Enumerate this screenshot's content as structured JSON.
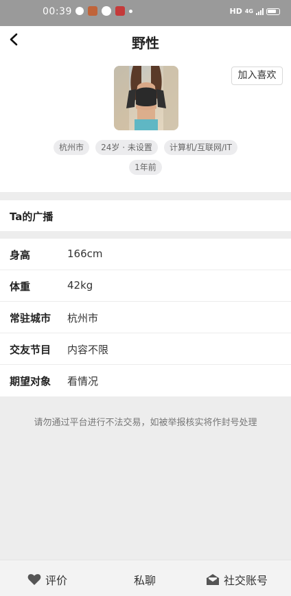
{
  "status_bar": {
    "time": "00:39",
    "network": "HD",
    "signal_type": "4G"
  },
  "header": {
    "title": "野性"
  },
  "profile": {
    "favorite_label": "加入喜欢",
    "tags": [
      "杭州市",
      "24岁 · 未设置",
      "计算机/互联网/IT"
    ],
    "last_active": "1年前"
  },
  "broadcast": {
    "title": "Ta的广播"
  },
  "info": [
    {
      "key": "身高",
      "value": "166cm"
    },
    {
      "key": "体重",
      "value": "42kg"
    },
    {
      "key": "常驻城市",
      "value": "杭州市"
    },
    {
      "key": "交友节目",
      "value": "内容不限"
    },
    {
      "key": "期望对象",
      "value": "看情况"
    }
  ],
  "notice": "请勿通过平台进行不法交易，如被举报核实将作封号处理",
  "bottom_bar": {
    "rate_label": "评价",
    "chat_label": "私聊",
    "social_label": "社交账号"
  },
  "colors": {
    "status_bar_bg": "#9a9a9a",
    "page_bg": "#ededed",
    "tag_bg": "#ececee"
  }
}
